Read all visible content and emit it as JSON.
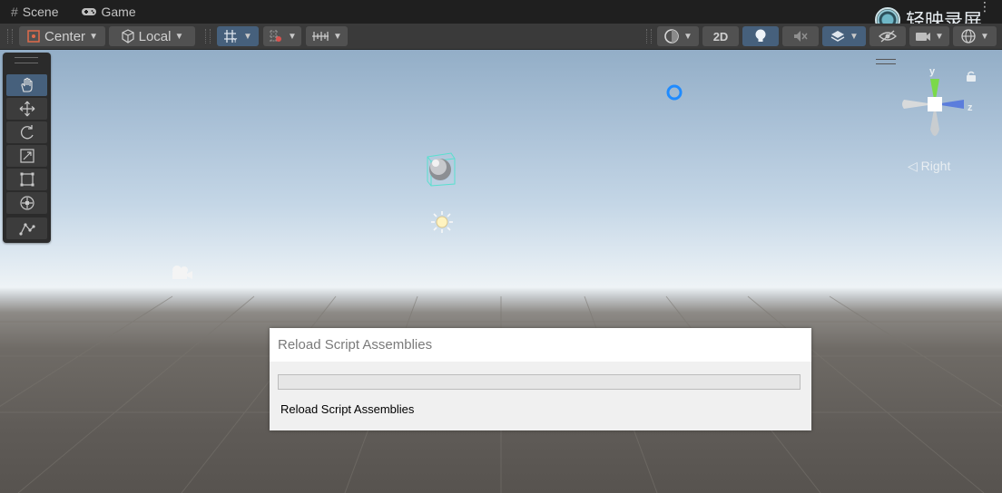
{
  "tabs": [
    {
      "label": "Scene",
      "icon": "grid-icon"
    },
    {
      "label": "Game",
      "icon": "gamepad-icon"
    }
  ],
  "watermark": {
    "text": "轻映录屏"
  },
  "toolbar": {
    "pivot_mode": "Center",
    "pivot_rotation": "Local",
    "view_2d": "2D"
  },
  "tools": [
    "hand-tool",
    "move-tool",
    "rotate-tool",
    "scale-tool",
    "rect-tool",
    "transform-tool",
    "custom-tool"
  ],
  "gizmo": {
    "y": "y",
    "z": "z",
    "view": "Right"
  },
  "dialog": {
    "title": "Reload Script Assemblies",
    "status": "Reload Script Assemblies",
    "progress": 0
  },
  "colors": {
    "accent_active": "#46607c",
    "progress_green": "#06b025"
  }
}
